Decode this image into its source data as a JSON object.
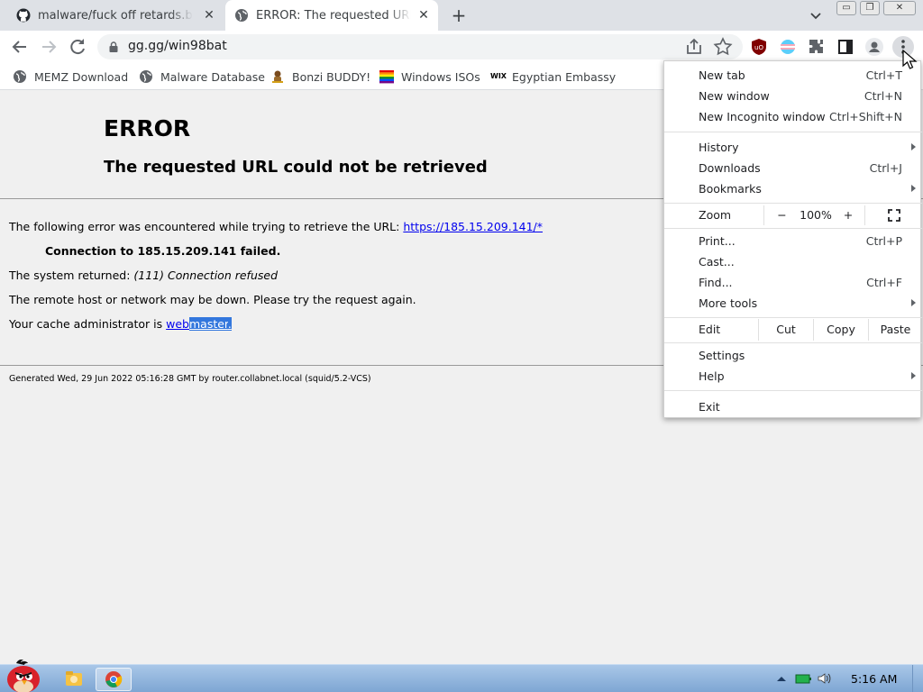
{
  "tabs": [
    {
      "title": "malware/fuck off retards.bat at",
      "icon": "github-icon",
      "active": false
    },
    {
      "title": "ERROR: The requested URL cou",
      "icon": "globe-icon",
      "active": true
    }
  ],
  "window_controls": {
    "minimize": "▭",
    "restore": "❐",
    "close": "✕"
  },
  "toolbar": {
    "url": "gg.gg/win98bat"
  },
  "bookmarks": [
    {
      "label": "MEMZ Download",
      "icon": "globe-icon"
    },
    {
      "label": "Malware Database",
      "icon": "globe-icon"
    },
    {
      "label": "Bonzi BUDDY!",
      "icon": "bonzi-icon"
    },
    {
      "label": "Windows ISOs",
      "icon": "rainbow-flag-icon"
    },
    {
      "label": "Egyptian Embassy",
      "icon": "wix-icon",
      "icon_text": "WIX"
    }
  ],
  "page": {
    "title": "ERROR",
    "subtitle": "The requested URL could not be retrieved",
    "line1_text": "The following error was encountered while trying to retrieve the URL: ",
    "line1_link": "https://185.15.209.141/*",
    "line2": "Connection to 185.15.209.141 failed.",
    "line3_text": "The system returned: ",
    "line3_em": "(111) Connection refused",
    "line4": "The remote host or network may be down. Please try the request again.",
    "line5_text": "Your cache administrator is ",
    "line5_link_a": "web",
    "line5_link_b": "master",
    "line5_end": ".",
    "footer": "Generated Wed, 29 Jun 2022 05:16:28 GMT by router.collabnet.local (squid/5.2-VCS)"
  },
  "menu": {
    "new_tab": {
      "label": "New tab",
      "shortcut": "Ctrl+T"
    },
    "new_window": {
      "label": "New window",
      "shortcut": "Ctrl+N"
    },
    "incognito": {
      "label": "New Incognito window",
      "shortcut": "Ctrl+Shift+N"
    },
    "history": {
      "label": "History"
    },
    "downloads": {
      "label": "Downloads",
      "shortcut": "Ctrl+J"
    },
    "bookmarks": {
      "label": "Bookmarks"
    },
    "zoom": {
      "label": "Zoom",
      "minus": "−",
      "level": "100%",
      "plus": "+"
    },
    "print": {
      "label": "Print...",
      "shortcut": "Ctrl+P"
    },
    "cast": {
      "label": "Cast..."
    },
    "find": {
      "label": "Find...",
      "shortcut": "Ctrl+F"
    },
    "more_tools": {
      "label": "More tools"
    },
    "edit": {
      "label": "Edit",
      "cut": "Cut",
      "copy": "Copy",
      "paste": "Paste"
    },
    "settings": {
      "label": "Settings"
    },
    "help": {
      "label": "Help"
    },
    "exit": {
      "label": "Exit"
    }
  },
  "taskbar": {
    "clock": "5:16 AM"
  },
  "colors": {
    "link": "#0000ee",
    "selection": "#3377dd",
    "tabstrip": "#dee1e6",
    "taskbar": "#8fb3dc"
  }
}
